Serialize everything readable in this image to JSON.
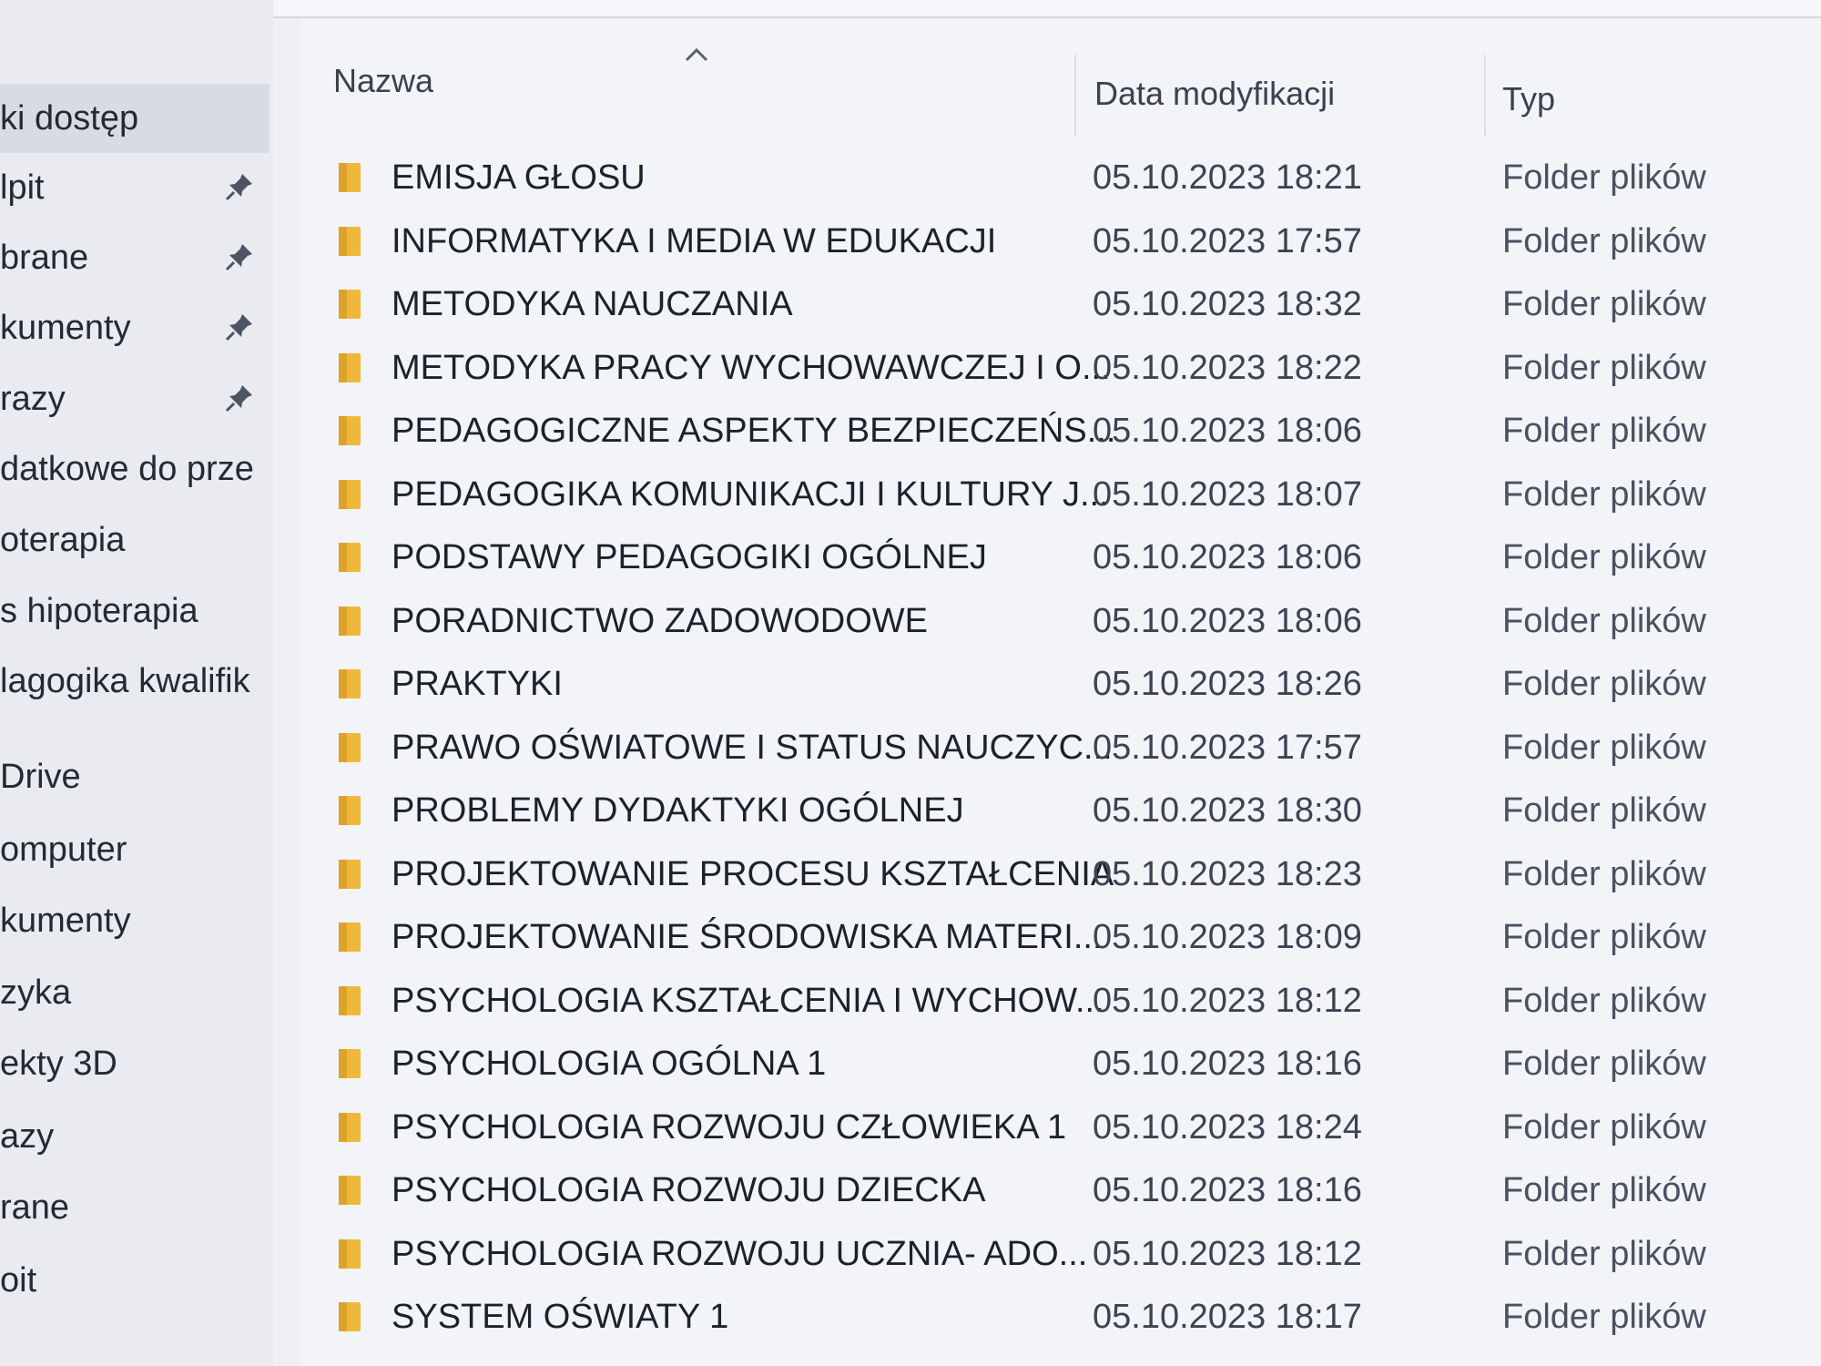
{
  "sidebar": {
    "items": [
      {
        "label": "ki dostęp",
        "pinned": false,
        "selected": true
      },
      {
        "label": "lpit",
        "pinned": true
      },
      {
        "label": "brane",
        "pinned": true
      },
      {
        "label": "kumenty",
        "pinned": true
      },
      {
        "label": "razy",
        "pinned": true
      },
      {
        "label": "datkowe do prze",
        "pinned": false
      },
      {
        "label": "oterapia",
        "pinned": false
      },
      {
        "label": "s hipoterapia",
        "pinned": false
      },
      {
        "label": "lagogika kwalifik",
        "pinned": false
      },
      {
        "label": "Drive",
        "pinned": false
      },
      {
        "label": "omputer",
        "pinned": false
      },
      {
        "label": "kumenty",
        "pinned": false
      },
      {
        "label": "zyka",
        "pinned": false
      },
      {
        "label": "ekty 3D",
        "pinned": false
      },
      {
        "label": "azy",
        "pinned": false
      },
      {
        "label": "rane",
        "pinned": false
      },
      {
        "label": "oit",
        "pinned": false
      }
    ]
  },
  "columns": {
    "name": "Nazwa",
    "date": "Data modyfikacji",
    "type": "Typ"
  },
  "sort": {
    "column": "name",
    "direction": "ascending"
  },
  "files": [
    {
      "name": "EMISJA GŁOSU",
      "date": "05.10.2023 18:21",
      "type": "Folder plików"
    },
    {
      "name": "INFORMATYKA I MEDIA W EDUKACJI",
      "date": "05.10.2023 17:57",
      "type": "Folder plików"
    },
    {
      "name": "METODYKA NAUCZANIA",
      "date": "05.10.2023 18:32",
      "type": "Folder plików"
    },
    {
      "name": "METODYKA PRACY WYCHOWAWCZEJ I O...",
      "date": "05.10.2023 18:22",
      "type": "Folder plików"
    },
    {
      "name": "PEDAGOGICZNE ASPEKTY BEZPIECZEŃS...",
      "date": "05.10.2023 18:06",
      "type": "Folder plików"
    },
    {
      "name": "PEDAGOGIKA KOMUNIKACJI I KULTURY J...",
      "date": "05.10.2023 18:07",
      "type": "Folder plików"
    },
    {
      "name": "PODSTAWY PEDAGOGIKI OGÓLNEJ",
      "date": "05.10.2023 18:06",
      "type": "Folder plików"
    },
    {
      "name": "PORADNICTWO ZADOWODOWE",
      "date": "05.10.2023 18:06",
      "type": "Folder plików"
    },
    {
      "name": "PRAKTYKI",
      "date": "05.10.2023 18:26",
      "type": "Folder plików"
    },
    {
      "name": "PRAWO OŚWIATOWE I STATUS NAUCZYC...",
      "date": "05.10.2023 17:57",
      "type": "Folder plików"
    },
    {
      "name": "PROBLEMY DYDAKTYKI OGÓLNEJ",
      "date": "05.10.2023 18:30",
      "type": "Folder plików"
    },
    {
      "name": "PROJEKTOWANIE PROCESU KSZTAŁCENIA",
      "date": "05.10.2023 18:23",
      "type": "Folder plików"
    },
    {
      "name": "PROJEKTOWANIE ŚRODOWISKA MATERI...",
      "date": "05.10.2023 18:09",
      "type": "Folder plików"
    },
    {
      "name": "PSYCHOLOGIA KSZTAŁCENIA I WYCHOW...",
      "date": "05.10.2023 18:12",
      "type": "Folder plików"
    },
    {
      "name": "PSYCHOLOGIA OGÓLNA 1",
      "date": "05.10.2023 18:16",
      "type": "Folder plików"
    },
    {
      "name": "PSYCHOLOGIA ROZWOJU CZŁOWIEKA 1",
      "date": "05.10.2023 18:24",
      "type": "Folder plików"
    },
    {
      "name": "PSYCHOLOGIA ROZWOJU DZIECKA",
      "date": "05.10.2023 18:16",
      "type": "Folder plików"
    },
    {
      "name": "PSYCHOLOGIA ROZWOJU UCZNIA- ADO...",
      "date": "05.10.2023 18:12",
      "type": "Folder plików"
    },
    {
      "name": "SYSTEM OŚWIATY 1",
      "date": "05.10.2023 18:17",
      "type": "Folder plików"
    }
  ],
  "icons": {
    "folder": "folder-icon",
    "pin": "pin-icon",
    "sort": "sort-ascending-icon"
  },
  "colors": {
    "folder": "#f0b83a",
    "selected": "#d8dbe3",
    "background": "#f3f4f8"
  }
}
